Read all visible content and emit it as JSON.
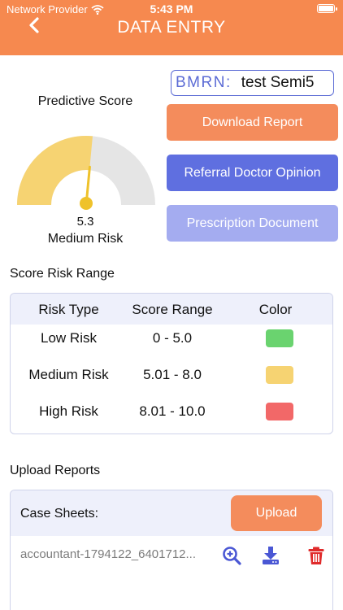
{
  "status_bar": {
    "carrier": "Network Provider",
    "time": "5:43 PM"
  },
  "header": {
    "title": "DATA ENTRY"
  },
  "bmrn": {
    "label": "BMRN:",
    "value": "test Semi5"
  },
  "predictive": {
    "label": "Predictive Score",
    "score": "5.3",
    "score_value": 5.3,
    "score_max": 10,
    "risk_level": "Medium Risk",
    "fill_color": "#f6d372",
    "track_color": "#e5e5e5",
    "needle_color": "#efc22b"
  },
  "actions": {
    "download_report": "Download Report",
    "referral_opinion": "Referral Doctor Opinion",
    "prescription_document": "Prescription Document"
  },
  "risk_range": {
    "title": "Score Risk Range",
    "headers": [
      "Risk Type",
      "Score Range",
      "Color"
    ],
    "rows": [
      {
        "type": "Low Risk",
        "range": "0 - 5.0",
        "color": "#6ad36f"
      },
      {
        "type": "Medium Risk",
        "range": "5.01 - 8.0",
        "color": "#f6d372"
      },
      {
        "type": "High Risk",
        "range": "8.01 - 10.0",
        "color": "#f26868"
      }
    ]
  },
  "upload": {
    "title": "Upload Reports",
    "case_label": "Case Sheets:",
    "upload_label": "Upload",
    "files": [
      {
        "name": "accountant-1794122_6401712..."
      }
    ]
  },
  "colors": {
    "brand_orange": "#f6894f",
    "primary_blue": "#5f6fe0",
    "light_blue": "#a4acf0",
    "delete_red": "#e02b2b"
  }
}
